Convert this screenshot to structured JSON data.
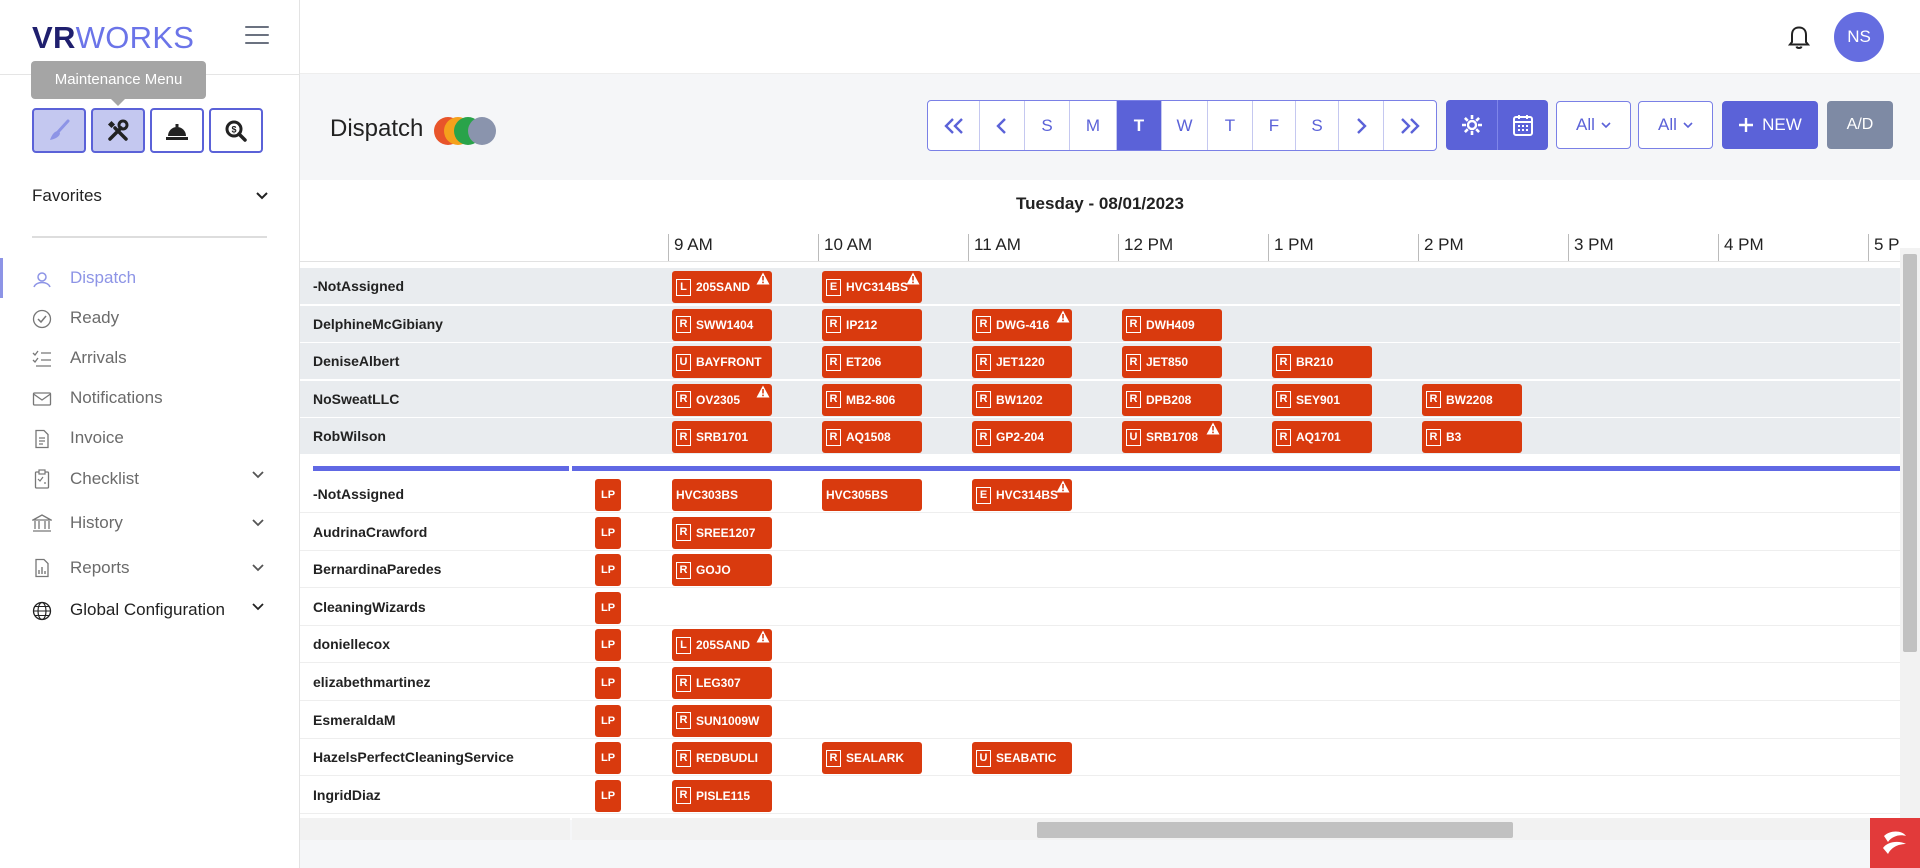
{
  "brand": {
    "part1": "VR",
    "part2": "WORKS"
  },
  "tooltip": "Maintenance Menu",
  "sidebar": {
    "favorites_label": "Favorites",
    "items": [
      {
        "label": "Dispatch",
        "active": true
      },
      {
        "label": "Ready"
      },
      {
        "label": "Arrivals"
      },
      {
        "label": "Notifications"
      },
      {
        "label": "Invoice"
      },
      {
        "label": "Checklist",
        "expandable": true
      },
      {
        "label": "History",
        "expandable": true
      },
      {
        "label": "Reports",
        "expandable": true
      },
      {
        "label": "Global Configuration",
        "expandable": true
      }
    ]
  },
  "user": {
    "initials": "NS"
  },
  "page": {
    "title": "Dispatch"
  },
  "day_nav": {
    "days": [
      "S",
      "M",
      "T",
      "W",
      "T",
      "F",
      "S"
    ],
    "active_index": 2
  },
  "filters": {
    "filter1": "All",
    "filter2": "All"
  },
  "buttons": {
    "new": "NEW",
    "ad": "A/D"
  },
  "schedule": {
    "date_title": "Tuesday - 08/01/2023",
    "hours": [
      "9 AM",
      "10 AM",
      "11 AM",
      "12 PM",
      "1 PM",
      "2 PM",
      "3 PM",
      "4 PM",
      "5 P"
    ],
    "maintenance_rows": [
      {
        "name": "-NotAssigned",
        "events": [
          {
            "hour": 0,
            "badge": "L",
            "label": "205SAND",
            "warn": true
          },
          {
            "hour": 1,
            "badge": "E",
            "label": "HVC314BS",
            "warn": true
          }
        ]
      },
      {
        "name": "DelphineMcGibiany",
        "events": [
          {
            "hour": 0,
            "badge": "R",
            "label": "SWW1404"
          },
          {
            "hour": 1,
            "badge": "R",
            "label": "IP212"
          },
          {
            "hour": 2,
            "badge": "R",
            "label": "DWG-416",
            "warn": true
          },
          {
            "hour": 3,
            "badge": "R",
            "label": "DWH409"
          }
        ]
      },
      {
        "name": "DeniseAlbert",
        "events": [
          {
            "hour": 0,
            "badge": "U",
            "label": "BAYFRONT"
          },
          {
            "hour": 1,
            "badge": "R",
            "label": "ET206"
          },
          {
            "hour": 2,
            "badge": "R",
            "label": "JET1220"
          },
          {
            "hour": 3,
            "badge": "R",
            "label": "JET850"
          },
          {
            "hour": 4,
            "badge": "R",
            "label": "BR210"
          }
        ]
      },
      {
        "name": "NoSweatLLC",
        "events": [
          {
            "hour": 0,
            "badge": "R",
            "label": "OV2305",
            "warn": true
          },
          {
            "hour": 1,
            "badge": "R",
            "label": "MB2-806"
          },
          {
            "hour": 2,
            "badge": "R",
            "label": "BW1202"
          },
          {
            "hour": 3,
            "badge": "R",
            "label": "DPB208"
          },
          {
            "hour": 4,
            "badge": "R",
            "label": "SEY901"
          },
          {
            "hour": 5,
            "badge": "R",
            "label": "BW2208"
          }
        ]
      },
      {
        "name": "RobWilson",
        "events": [
          {
            "hour": 0,
            "badge": "R",
            "label": "SRB1701"
          },
          {
            "hour": 1,
            "badge": "R",
            "label": "AQ1508"
          },
          {
            "hour": 2,
            "badge": "R",
            "label": "GP2-204"
          },
          {
            "hour": 3,
            "badge": "U",
            "label": "SRB1708",
            "warn": true
          },
          {
            "hour": 4,
            "badge": "R",
            "label": "AQ1701"
          },
          {
            "hour": 5,
            "badge": "R",
            "label": "B3"
          }
        ]
      }
    ],
    "cleaning_rows": [
      {
        "name": "-NotAssigned",
        "lp": "LP",
        "events": [
          {
            "hour": 0,
            "badge": "",
            "label": "HVC303BS"
          },
          {
            "hour": 1,
            "badge": "",
            "label": "HVC305BS"
          },
          {
            "hour": 2,
            "badge": "E",
            "label": "HVC314BS",
            "warn": true
          }
        ]
      },
      {
        "name": "AudrinaCrawford",
        "lp": "LP",
        "events": [
          {
            "hour": 0,
            "badge": "R",
            "label": "SREE1207"
          }
        ]
      },
      {
        "name": "BernardinaParedes",
        "lp": "LP",
        "events": [
          {
            "hour": 0,
            "badge": "R",
            "label": "GOJO"
          }
        ]
      },
      {
        "name": "CleaningWizards",
        "lp": "LP",
        "events": []
      },
      {
        "name": "doniellecox",
        "lp": "LP",
        "events": [
          {
            "hour": 0,
            "badge": "L",
            "label": "205SAND",
            "warn": true
          }
        ]
      },
      {
        "name": "elizabethmartinez",
        "lp": "LP",
        "events": [
          {
            "hour": 0,
            "badge": "R",
            "label": "LEG307"
          }
        ]
      },
      {
        "name": "EsmeraldaM",
        "lp": "LP",
        "events": [
          {
            "hour": 0,
            "badge": "R",
            "label": "SUN1009W"
          }
        ]
      },
      {
        "name": "HazelsPerfectCleaningService",
        "lp": "LP",
        "events": [
          {
            "hour": 0,
            "badge": "R",
            "label": "REDBUDLI"
          },
          {
            "hour": 1,
            "badge": "R",
            "label": "SEALARK"
          },
          {
            "hour": 2,
            "badge": "U",
            "label": "SEABATIC"
          }
        ]
      },
      {
        "name": "IngridDiaz",
        "lp": "LP",
        "events": [
          {
            "hour": 0,
            "badge": "R",
            "label": "PISLE115"
          }
        ]
      }
    ]
  }
}
